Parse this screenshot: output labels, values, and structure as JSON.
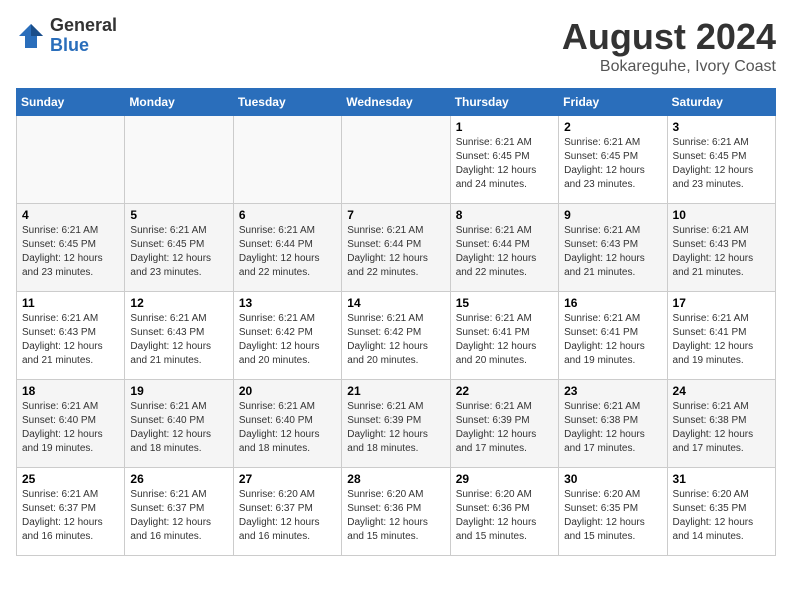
{
  "logo": {
    "general": "General",
    "blue": "Blue"
  },
  "header": {
    "month": "August 2024",
    "location": "Bokareguhe, Ivory Coast"
  },
  "weekdays": [
    "Sunday",
    "Monday",
    "Tuesday",
    "Wednesday",
    "Thursday",
    "Friday",
    "Saturday"
  ],
  "weeks": [
    [
      {
        "day": "",
        "info": ""
      },
      {
        "day": "",
        "info": ""
      },
      {
        "day": "",
        "info": ""
      },
      {
        "day": "",
        "info": ""
      },
      {
        "day": "1",
        "info": "Sunrise: 6:21 AM\nSunset: 6:45 PM\nDaylight: 12 hours\nand 24 minutes."
      },
      {
        "day": "2",
        "info": "Sunrise: 6:21 AM\nSunset: 6:45 PM\nDaylight: 12 hours\nand 23 minutes."
      },
      {
        "day": "3",
        "info": "Sunrise: 6:21 AM\nSunset: 6:45 PM\nDaylight: 12 hours\nand 23 minutes."
      }
    ],
    [
      {
        "day": "4",
        "info": "Sunrise: 6:21 AM\nSunset: 6:45 PM\nDaylight: 12 hours\nand 23 minutes."
      },
      {
        "day": "5",
        "info": "Sunrise: 6:21 AM\nSunset: 6:45 PM\nDaylight: 12 hours\nand 23 minutes."
      },
      {
        "day": "6",
        "info": "Sunrise: 6:21 AM\nSunset: 6:44 PM\nDaylight: 12 hours\nand 22 minutes."
      },
      {
        "day": "7",
        "info": "Sunrise: 6:21 AM\nSunset: 6:44 PM\nDaylight: 12 hours\nand 22 minutes."
      },
      {
        "day": "8",
        "info": "Sunrise: 6:21 AM\nSunset: 6:44 PM\nDaylight: 12 hours\nand 22 minutes."
      },
      {
        "day": "9",
        "info": "Sunrise: 6:21 AM\nSunset: 6:43 PM\nDaylight: 12 hours\nand 21 minutes."
      },
      {
        "day": "10",
        "info": "Sunrise: 6:21 AM\nSunset: 6:43 PM\nDaylight: 12 hours\nand 21 minutes."
      }
    ],
    [
      {
        "day": "11",
        "info": "Sunrise: 6:21 AM\nSunset: 6:43 PM\nDaylight: 12 hours\nand 21 minutes."
      },
      {
        "day": "12",
        "info": "Sunrise: 6:21 AM\nSunset: 6:43 PM\nDaylight: 12 hours\nand 21 minutes."
      },
      {
        "day": "13",
        "info": "Sunrise: 6:21 AM\nSunset: 6:42 PM\nDaylight: 12 hours\nand 20 minutes."
      },
      {
        "day": "14",
        "info": "Sunrise: 6:21 AM\nSunset: 6:42 PM\nDaylight: 12 hours\nand 20 minutes."
      },
      {
        "day": "15",
        "info": "Sunrise: 6:21 AM\nSunset: 6:41 PM\nDaylight: 12 hours\nand 20 minutes."
      },
      {
        "day": "16",
        "info": "Sunrise: 6:21 AM\nSunset: 6:41 PM\nDaylight: 12 hours\nand 19 minutes."
      },
      {
        "day": "17",
        "info": "Sunrise: 6:21 AM\nSunset: 6:41 PM\nDaylight: 12 hours\nand 19 minutes."
      }
    ],
    [
      {
        "day": "18",
        "info": "Sunrise: 6:21 AM\nSunset: 6:40 PM\nDaylight: 12 hours\nand 19 minutes."
      },
      {
        "day": "19",
        "info": "Sunrise: 6:21 AM\nSunset: 6:40 PM\nDaylight: 12 hours\nand 18 minutes."
      },
      {
        "day": "20",
        "info": "Sunrise: 6:21 AM\nSunset: 6:40 PM\nDaylight: 12 hours\nand 18 minutes."
      },
      {
        "day": "21",
        "info": "Sunrise: 6:21 AM\nSunset: 6:39 PM\nDaylight: 12 hours\nand 18 minutes."
      },
      {
        "day": "22",
        "info": "Sunrise: 6:21 AM\nSunset: 6:39 PM\nDaylight: 12 hours\nand 17 minutes."
      },
      {
        "day": "23",
        "info": "Sunrise: 6:21 AM\nSunset: 6:38 PM\nDaylight: 12 hours\nand 17 minutes."
      },
      {
        "day": "24",
        "info": "Sunrise: 6:21 AM\nSunset: 6:38 PM\nDaylight: 12 hours\nand 17 minutes."
      }
    ],
    [
      {
        "day": "25",
        "info": "Sunrise: 6:21 AM\nSunset: 6:37 PM\nDaylight: 12 hours\nand 16 minutes."
      },
      {
        "day": "26",
        "info": "Sunrise: 6:21 AM\nSunset: 6:37 PM\nDaylight: 12 hours\nand 16 minutes."
      },
      {
        "day": "27",
        "info": "Sunrise: 6:20 AM\nSunset: 6:37 PM\nDaylight: 12 hours\nand 16 minutes."
      },
      {
        "day": "28",
        "info": "Sunrise: 6:20 AM\nSunset: 6:36 PM\nDaylight: 12 hours\nand 15 minutes."
      },
      {
        "day": "29",
        "info": "Sunrise: 6:20 AM\nSunset: 6:36 PM\nDaylight: 12 hours\nand 15 minutes."
      },
      {
        "day": "30",
        "info": "Sunrise: 6:20 AM\nSunset: 6:35 PM\nDaylight: 12 hours\nand 15 minutes."
      },
      {
        "day": "31",
        "info": "Sunrise: 6:20 AM\nSunset: 6:35 PM\nDaylight: 12 hours\nand 14 minutes."
      }
    ]
  ]
}
